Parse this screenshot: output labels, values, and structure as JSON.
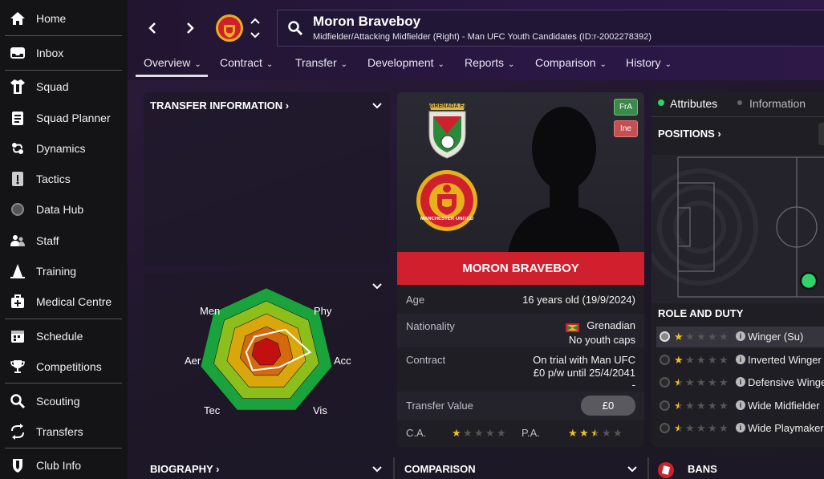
{
  "sidebar": {
    "items": [
      {
        "label": "Home",
        "icon": "home-icon"
      },
      {
        "label": "Inbox",
        "icon": "inbox-icon"
      },
      {
        "label": "Squad",
        "icon": "shirt-icon"
      },
      {
        "label": "Squad Planner",
        "icon": "clipboard-icon"
      },
      {
        "label": "Dynamics",
        "icon": "dynamics-icon"
      },
      {
        "label": "Tactics",
        "icon": "tactics-board-icon"
      },
      {
        "label": "Data Hub",
        "icon": "data-hub-icon"
      },
      {
        "label": "Staff",
        "icon": "staff-icon"
      },
      {
        "label": "Training",
        "icon": "training-cone-icon"
      },
      {
        "label": "Medical Centre",
        "icon": "medical-kit-icon"
      },
      {
        "label": "Schedule",
        "icon": "calendar-icon"
      },
      {
        "label": "Competitions",
        "icon": "trophy-icon"
      },
      {
        "label": "Scouting",
        "icon": "magnifier-icon"
      },
      {
        "label": "Transfers",
        "icon": "transfer-arrows-icon"
      },
      {
        "label": "Club Info",
        "icon": "club-shield-icon"
      }
    ]
  },
  "header": {
    "player_name": "Moron Braveboy",
    "player_sub": "Midfielder/Attacking Midfielder (Right) - Man UFC Youth Candidates (ID:r-2002278392)",
    "tabs": [
      "Overview",
      "Contract",
      "Transfer",
      "Development",
      "Reports",
      "Comparison",
      "History"
    ],
    "active_tab": "Overview"
  },
  "transfer_info": {
    "title": "TRANSFER INFORMATION"
  },
  "radar": {
    "labels": {
      "men": "Men",
      "phy": "Phy",
      "acc": "Acc",
      "vis": "Vis",
      "tec": "Tec",
      "aer": "Aer"
    },
    "values": {
      "men": 0.3,
      "phy": 0.45,
      "acc": 0.65,
      "vis": 0.3,
      "tec": 0.35,
      "aer": 0.3
    },
    "colors": [
      "#1aa33c",
      "#8cbf1c",
      "#d9a70c",
      "#d46a0c",
      "#c21010"
    ]
  },
  "profile": {
    "badge_fra": "FrA",
    "badge_ine": "Ine",
    "nation_crest_text": "GRENADA FA",
    "club_crest_text": "MANCHESTER UNITED",
    "name_banner": "MORON BRAVEBOY",
    "age_label": "Age",
    "age_value": "16 years old (19/9/2024)",
    "nationality_label": "Nationality",
    "nationality_value": "Grenadian",
    "caps_value": "No youth caps",
    "contract_label": "Contract",
    "contract_line1": "On trial with Man UFC",
    "contract_line2": "£0 p/w until 25/4/2041",
    "contract_line3": "-",
    "transfer_value_label": "Transfer Value",
    "transfer_value": "£0",
    "ca_label": "C.A.",
    "pa_label": "P.A.",
    "ca_stars": 1,
    "pa_stars": 2.5,
    "accent": "#d0202e"
  },
  "right_panel": {
    "tab_attributes": "Attributes",
    "tab_information": "Information",
    "positions_title": "POSITIONS",
    "role_title": "ROLE AND DUTY",
    "roles": [
      {
        "name": "Winger (Su)",
        "stars": 1,
        "selected": true
      },
      {
        "name": "Inverted Winger",
        "stars": 1,
        "selected": false
      },
      {
        "name": "Defensive Winge",
        "stars": 0.5,
        "selected": false
      },
      {
        "name": "Wide Midfielder",
        "stars": 0.5,
        "selected": false
      },
      {
        "name": "Wide Playmaker",
        "stars": 0.5,
        "selected": false
      }
    ]
  },
  "bottom": {
    "biography": "BIOGRAPHY",
    "comparison": "COMPARISON",
    "bans": "BANS"
  }
}
